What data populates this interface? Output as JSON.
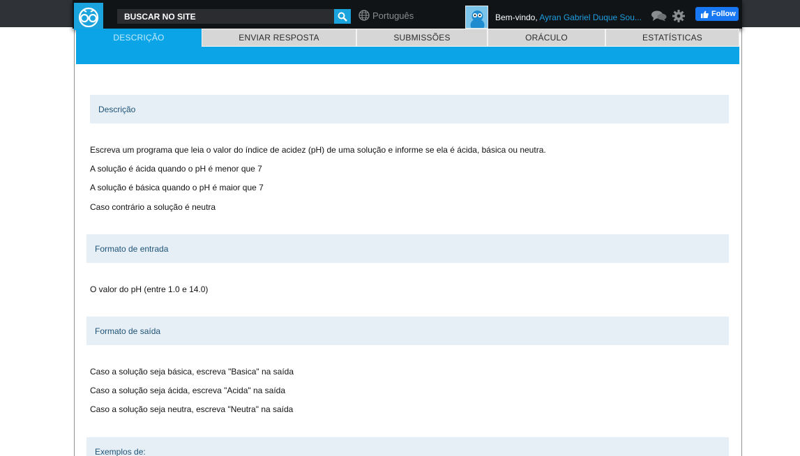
{
  "header": {
    "search_placeholder": "BUSCAR NO SITE",
    "language": "Português",
    "welcome": "Bem-vindo,",
    "user_name": "Ayran Gabriel Duque Sou...",
    "follow_label": "Follow",
    "accent_color": "#1aa3dd",
    "facebook_color": "#1877f2"
  },
  "tabs": [
    {
      "label": "DESCRIÇÃO",
      "active": true
    },
    {
      "label": "ENVIAR RESPOSTA",
      "active": false
    },
    {
      "label": "SUBMISSÕES",
      "active": false
    },
    {
      "label": "ORÁCULO",
      "active": false
    },
    {
      "label": "ESTATÍSTICAS",
      "active": false
    }
  ],
  "content": {
    "description": {
      "title": "Descrição",
      "lines": [
        "Escreva um programa que leia o valor do índice de acidez (pH) de uma solução e informe se ela é ácida, básica ou neutra.",
        "A solução é ácida quando o pH é menor que 7",
        "A solução é básica quando o pH é maior que 7",
        "Caso contrário a solução é neutra"
      ]
    },
    "input_format": {
      "title": "Formato de entrada",
      "lines": [
        "O valor do pH (entre 1.0 e 14.0)"
      ]
    },
    "output_format": {
      "title": "Formato de saída",
      "lines": [
        "Caso a solução seja básica, escreva \"Basica\" na saída",
        "Caso a solução seja ácida, escreva \"Acida\" na saída",
        "Caso a solução seja neutra, escreva \"Neutra\" na saída"
      ]
    },
    "examples": {
      "title": "Exemplos de:"
    }
  }
}
